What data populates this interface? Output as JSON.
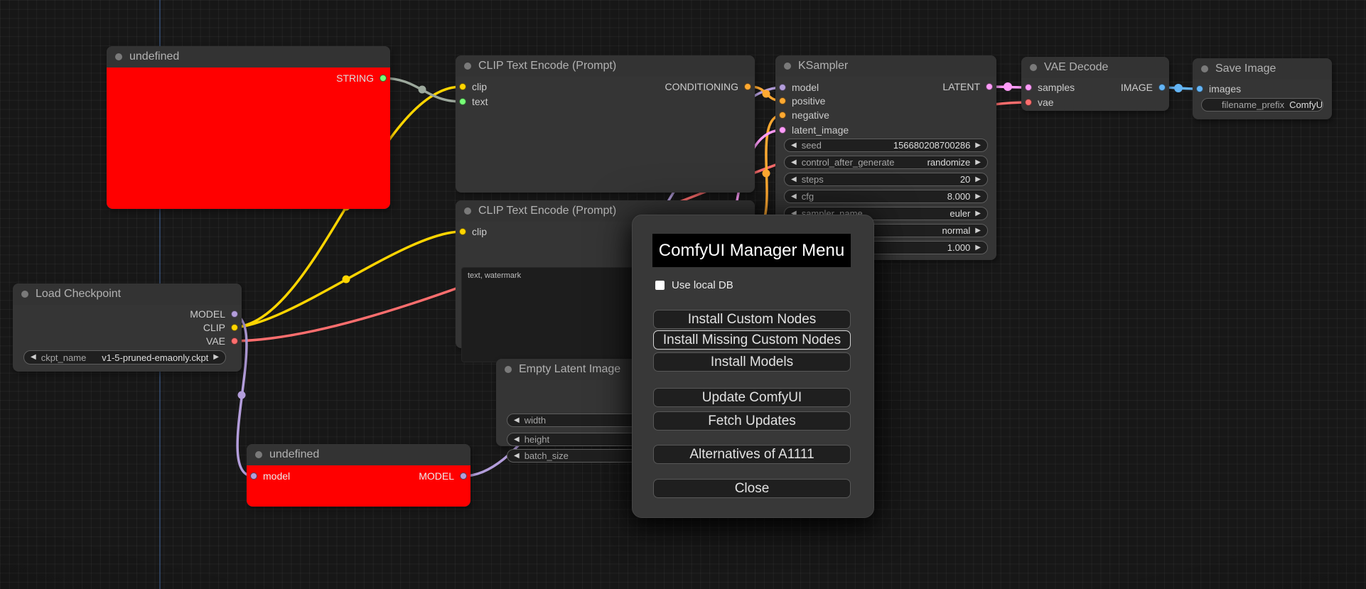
{
  "colors": {
    "clip": "#FFD500",
    "model": "#B39DDB",
    "vae": "#FF6E6E",
    "conditioning": "#FFA931",
    "latent": "#FF9CF9",
    "image": "#64B5F6",
    "string": "#77FF77",
    "string_link": "#9CA89C",
    "title_dot": "#7a7a7a",
    "error_node": "#FF0000"
  },
  "icons": {
    "arrow_left": "◀",
    "arrow_right": "▶"
  },
  "nodes": {
    "undefined_top": {
      "title": "undefined",
      "output": "STRING"
    },
    "clip_encode_pos": {
      "title": "CLIP Text Encode (Prompt)",
      "inputs": [
        "clip",
        "text"
      ],
      "output": "CONDITIONING"
    },
    "clip_encode_neg": {
      "title": "CLIP Text Encode (Prompt)",
      "inputs": [
        "clip"
      ],
      "prompt_text": "text, watermark"
    },
    "ksampler": {
      "title": "KSampler",
      "inputs": [
        "model",
        "positive",
        "negative",
        "latent_image"
      ],
      "output": "LATENT",
      "widgets": [
        {
          "label": "seed",
          "value": "156680208700286"
        },
        {
          "label": "control_after_generate",
          "value": "randomize"
        },
        {
          "label": "steps",
          "value": "20"
        },
        {
          "label": "cfg",
          "value": "8.000"
        },
        {
          "label": "sampler_name",
          "value": "euler"
        },
        {
          "label": "",
          "value": "normal"
        },
        {
          "label": "",
          "value": "1.000"
        }
      ]
    },
    "vae_decode": {
      "title": "VAE Decode",
      "inputs": [
        "samples",
        "vae"
      ],
      "output": "IMAGE"
    },
    "save_image": {
      "title": "Save Image",
      "inputs": [
        "images"
      ],
      "widget": {
        "label": "filename_prefix",
        "value": "ComfyUI"
      }
    },
    "load_checkpoint": {
      "title": "Load Checkpoint",
      "outputs": [
        "MODEL",
        "CLIP",
        "VAE"
      ],
      "widget": {
        "label": "ckpt_name",
        "value": "v1-5-pruned-emaonly.ckpt"
      }
    },
    "empty_latent": {
      "title": "Empty Latent Image",
      "widgets": [
        {
          "label": "width"
        },
        {
          "label": "height"
        },
        {
          "label": "batch_size"
        }
      ]
    },
    "undefined_bottom": {
      "title": "undefined",
      "input": "model",
      "output": "MODEL"
    }
  },
  "dialog": {
    "title": "ComfyUI Manager Menu",
    "checkbox_label": "Use local DB",
    "buttons": [
      "Install Custom Nodes",
      "Install Missing Custom Nodes",
      "Install Models",
      "Update ComfyUI",
      "Fetch Updates",
      "Alternatives of A1111",
      "Close"
    ]
  }
}
